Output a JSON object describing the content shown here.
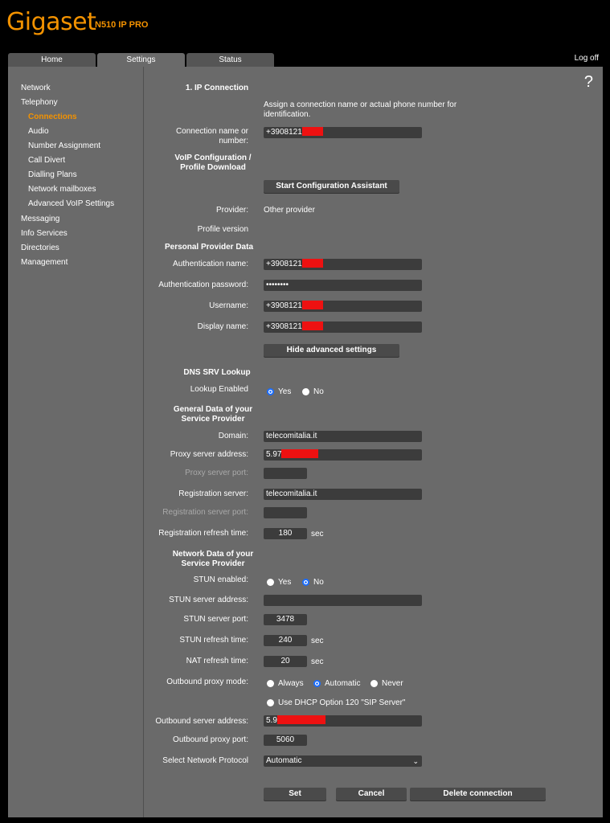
{
  "brand": {
    "logo": "Gigaset",
    "model": "N510 IP PRO"
  },
  "tabs": [
    {
      "label": "Home"
    },
    {
      "label": "Settings"
    },
    {
      "label": "Status"
    }
  ],
  "logoff": "Log off",
  "help": "?",
  "sidebar": {
    "items": [
      {
        "label": "Network"
      },
      {
        "label": "Telephony"
      },
      {
        "label": "Connections"
      },
      {
        "label": "Audio"
      },
      {
        "label": "Number Assignment"
      },
      {
        "label": "Call Divert"
      },
      {
        "label": "Dialling Plans"
      },
      {
        "label": "Network mailboxes"
      },
      {
        "label": "Advanced VoIP Settings"
      },
      {
        "label": "Messaging"
      },
      {
        "label": "Info Services"
      },
      {
        "label": "Directories"
      },
      {
        "label": "Management"
      }
    ]
  },
  "form": {
    "section_ip": "1. IP Connection",
    "assign_note": "Assign a connection name or actual phone number for identification.",
    "conn_name_label": "Connection name or number:",
    "conn_name_value": "+3908121",
    "voip_config_label": "VoIP Configuration / Profile Download",
    "start_assistant": "Start Configuration Assistant",
    "provider_label": "Provider:",
    "provider_value": "Other provider",
    "profile_version_label": "Profile version",
    "section_personal": "Personal Provider Data",
    "auth_name_label": "Authentication name:",
    "auth_name_value": "+3908121",
    "auth_pw_label": "Authentication password:",
    "auth_pw_value": "••••••••",
    "username_label": "Username:",
    "username_value": "+3908121",
    "display_label": "Display name:",
    "display_value": "+3908121",
    "hide_advanced": "Hide advanced settings",
    "section_dns": "DNS SRV Lookup",
    "lookup_label": "Lookup Enabled",
    "yes": "Yes",
    "no": "No",
    "section_general": "General Data of your Service Provider",
    "domain_label": "Domain:",
    "domain_value": "telecomitalia.it",
    "proxy_addr_label": "Proxy server address:",
    "proxy_addr_value": "5.97",
    "proxy_port_label": "Proxy server port:",
    "reg_server_label": "Registration server:",
    "reg_server_value": "telecomitalia.it",
    "reg_port_label": "Registration server port:",
    "reg_refresh_label": "Registration refresh time:",
    "reg_refresh_value": "180",
    "sec": "sec",
    "section_network": "Network Data of your Service Provider",
    "stun_enabled_label": "STUN enabled:",
    "stun_addr_label": "STUN server address:",
    "stun_port_label": "STUN server port:",
    "stun_port_value": "3478",
    "stun_refresh_label": "STUN refresh time:",
    "stun_refresh_value": "240",
    "nat_refresh_label": "NAT refresh time:",
    "nat_refresh_value": "20",
    "outbound_mode_label": "Outbound proxy mode:",
    "always": "Always",
    "automatic": "Automatic",
    "never": "Never",
    "dhcp_option": "Use DHCP Option 120 \"SIP Server\"",
    "outbound_addr_label": "Outbound server address:",
    "outbound_addr_value": "5.9",
    "outbound_port_label": "Outbound proxy port:",
    "outbound_port_value": "5060",
    "protocol_label": "Select Network Protocol",
    "protocol_value": "Automatic",
    "set": "Set",
    "cancel": "Cancel",
    "delete": "Delete connection"
  },
  "colors": {
    "accent": "#f39200",
    "panel": "#6a6a6a",
    "input": "#3c3c3c",
    "redaction": "#ee1111"
  }
}
